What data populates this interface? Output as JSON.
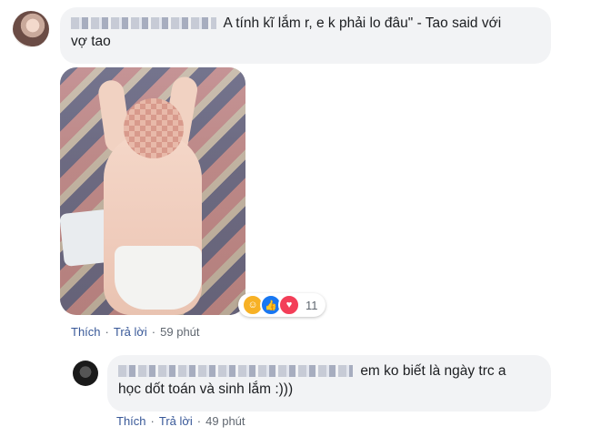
{
  "comment1": {
    "text_line1": "A tính kĩ lắm r, e k phải lo đâu\" - Tao said với",
    "text_line2": "vợ tao",
    "actions": {
      "like": "Thích",
      "reply": "Trả lời",
      "time": "59 phút"
    },
    "reactions": {
      "icons": [
        "haha-icon",
        "like-icon",
        "love-icon"
      ],
      "count": "11"
    }
  },
  "comment2": {
    "text_line1": "em ko biết là ngày trc a",
    "text_line2": "học dốt toán và sinh lắm :)))",
    "actions": {
      "like": "Thích",
      "reply": "Trả lời",
      "time": "49 phút"
    }
  },
  "colors": {
    "bubble": "#f2f3f5",
    "link": "#385898",
    "meta": "#606770",
    "like": "#1877f2",
    "love": "#f33e58",
    "haha": "#f7b125"
  }
}
